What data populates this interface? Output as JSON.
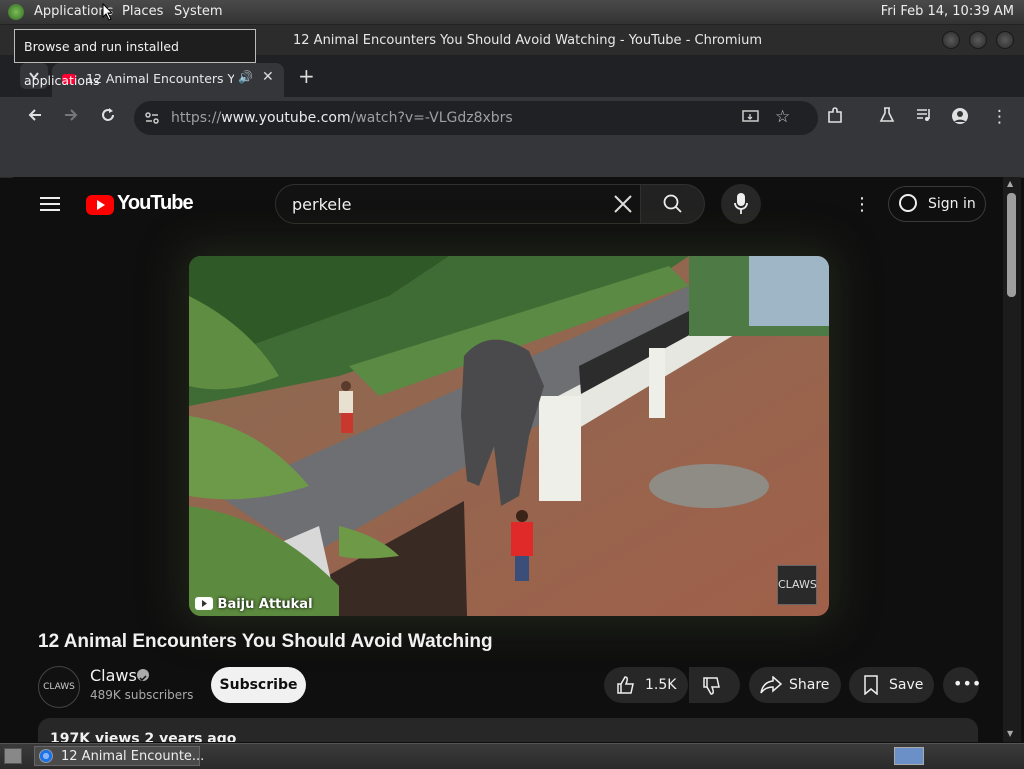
{
  "top_panel": {
    "menus": [
      "Applications",
      "Places",
      "System"
    ],
    "clock": "Fri Feb 14, 10:39 AM"
  },
  "tooltip": "Browse and run installed applications",
  "window": {
    "title": "12 Animal Encounters You Should Avoid Watching - YouTube - Chromium"
  },
  "tab": {
    "title": "12 Animal Encounters You Should Avoid Watching - YouTube",
    "audio_icon": "speaker-icon"
  },
  "toolbar": {
    "url_scheme": "https://",
    "url_host": "www.youtube.com",
    "url_path": "/watch?v=-VLGdz8xbrs"
  },
  "youtube": {
    "logo_text": "YouTube",
    "search_value": "perkele",
    "sign_in": "Sign in",
    "video": {
      "watermark_name": "Baiju Attukal",
      "watermark_logo": "CLAWS"
    },
    "title": "12 Animal Encounters You Should Avoid Watching",
    "channel": {
      "avatar_text": "CLAWS",
      "name": "Claws",
      "subscribers": "489K subscribers"
    },
    "subscribe": "Subscribe",
    "likes": "1.5K",
    "share": "Share",
    "save": "Save",
    "description_meta": "197K views  2 years ago"
  },
  "taskbar": {
    "task_label": "12 Animal Encounte..."
  },
  "colors": {
    "youtube_red": "#ff0000",
    "page_bg": "#0f0f0f",
    "chrome_toolbar": "#35363a"
  }
}
